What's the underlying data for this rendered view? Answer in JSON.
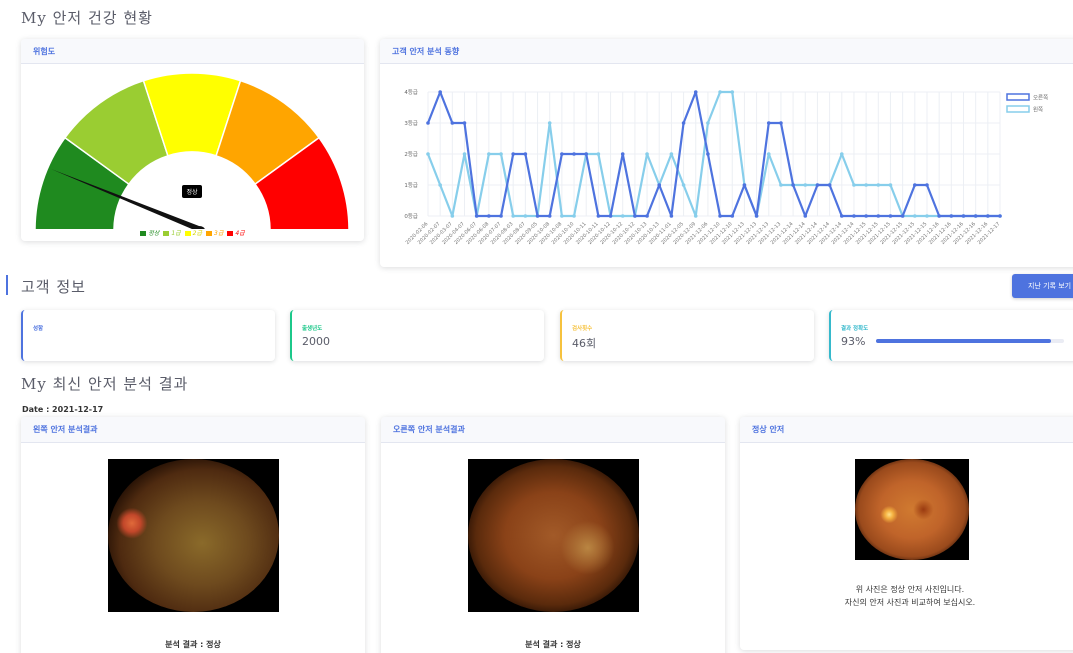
{
  "page": {
    "title": "My 안저 건강 현황",
    "customer_section_title": "고객 정보",
    "latest_section_title": "My 최신 안저 분석 결과",
    "history_button_label": "지난 기록 보기"
  },
  "risk_card": {
    "title": "위험도",
    "needle_label": "정상",
    "needle_level": "정상",
    "legend": [
      {
        "label": "정상",
        "color": "#1f8a1f"
      },
      {
        "label": "1급",
        "color": "#9acd32"
      },
      {
        "label": "2급",
        "color": "#ffff00"
      },
      {
        "label": "3급",
        "color": "#ffa500"
      },
      {
        "label": "4급",
        "color": "#ff0000"
      }
    ]
  },
  "trend_card": {
    "title": "고객 안저 분석 동향",
    "chart_data": {
      "type": "line",
      "y_tick_labels": [
        "0등급",
        "1등급",
        "2등급",
        "3등급",
        "4등급"
      ],
      "ylim": [
        0,
        4
      ],
      "x": [
        "2020-02-06",
        "2020-02-07",
        "2020-03-07",
        "2020-04-07",
        "2020-06-07",
        "2020-06-08",
        "2020-07-07",
        "2020-08-03",
        "2020-08-07",
        "2020-09-05",
        "2020-10-08",
        "2020-10-08",
        "2020-10-10",
        "2020-10-11",
        "2020-10-11",
        "2020-10-12",
        "2020-10-12",
        "2020-10-12",
        "2020-10-13",
        "2020-10-13",
        "2020-11-01",
        "2020-12-05",
        "2020-12-09",
        "2021-12-06",
        "2021-12-10",
        "2021-12-10",
        "2021-12-13",
        "2021-12-13",
        "2021-12-13",
        "2021-12-13",
        "2021-12-14",
        "2021-12-14",
        "2021-12-14",
        "2021-12-14",
        "2021-12-14",
        "2021-12-14",
        "2021-12-15",
        "2021-12-15",
        "2021-12-15",
        "2021-12-15",
        "2021-12-15",
        "2021-12-15",
        "2021-12-16",
        "2021-12-16",
        "2021-12-16",
        "2021-12-16",
        "2021-12-16",
        "2021-12-17"
      ],
      "series": [
        {
          "name": "오른쪽",
          "color": "#4e73df",
          "values": [
            3,
            4,
            3,
            3,
            0,
            0,
            0,
            2,
            2,
            0,
            0,
            2,
            2,
            2,
            0,
            0,
            2,
            0,
            0,
            1,
            0,
            3,
            4,
            2,
            0,
            0,
            1,
            0,
            3,
            3,
            1,
            0,
            1,
            1,
            0,
            0,
            0,
            0,
            0,
            0,
            1,
            1,
            0,
            0,
            0,
            0,
            0,
            0
          ]
        },
        {
          "name": "왼쪽",
          "color": "#87ceeb",
          "values": [
            2,
            1,
            0,
            2,
            0,
            2,
            2,
            0,
            0,
            0,
            3,
            0,
            0,
            2,
            2,
            0,
            0,
            0,
            2,
            1,
            2,
            1,
            0,
            3,
            4,
            4,
            1,
            0,
            2,
            1,
            1,
            1,
            1,
            1,
            2,
            1,
            1,
            1,
            1,
            0,
            0,
            0,
            0,
            0,
            0,
            0,
            0,
            0
          ]
        }
      ],
      "legend_position": "top-right",
      "grid": true
    }
  },
  "info_cards": [
    {
      "label": "성함",
      "value": "",
      "accent": "#4e73df"
    },
    {
      "label": "출생년도",
      "value": "2000",
      "accent": "#1cc88a"
    },
    {
      "label": "검사횟수",
      "value": "46회",
      "accent": "#f6c23e"
    },
    {
      "label": "결과 정확도",
      "value": "93%",
      "accent": "#36b9cc",
      "progress": 0.93
    }
  ],
  "latest": {
    "date_text": "Date : 2021-12-17",
    "left_title": "왼쪽 안저 분석결과",
    "left_result": "분석 결과 : 정상",
    "right_title": "오른쪽 안저 분석결과",
    "right_result": "분석 결과 : 정상",
    "normal_title": "정상 안저",
    "normal_desc_line1": "위 사진은 정상 안저 사진입니다.",
    "normal_desc_line2": "자신의 안저 사진과 비교하여 보십시오."
  }
}
